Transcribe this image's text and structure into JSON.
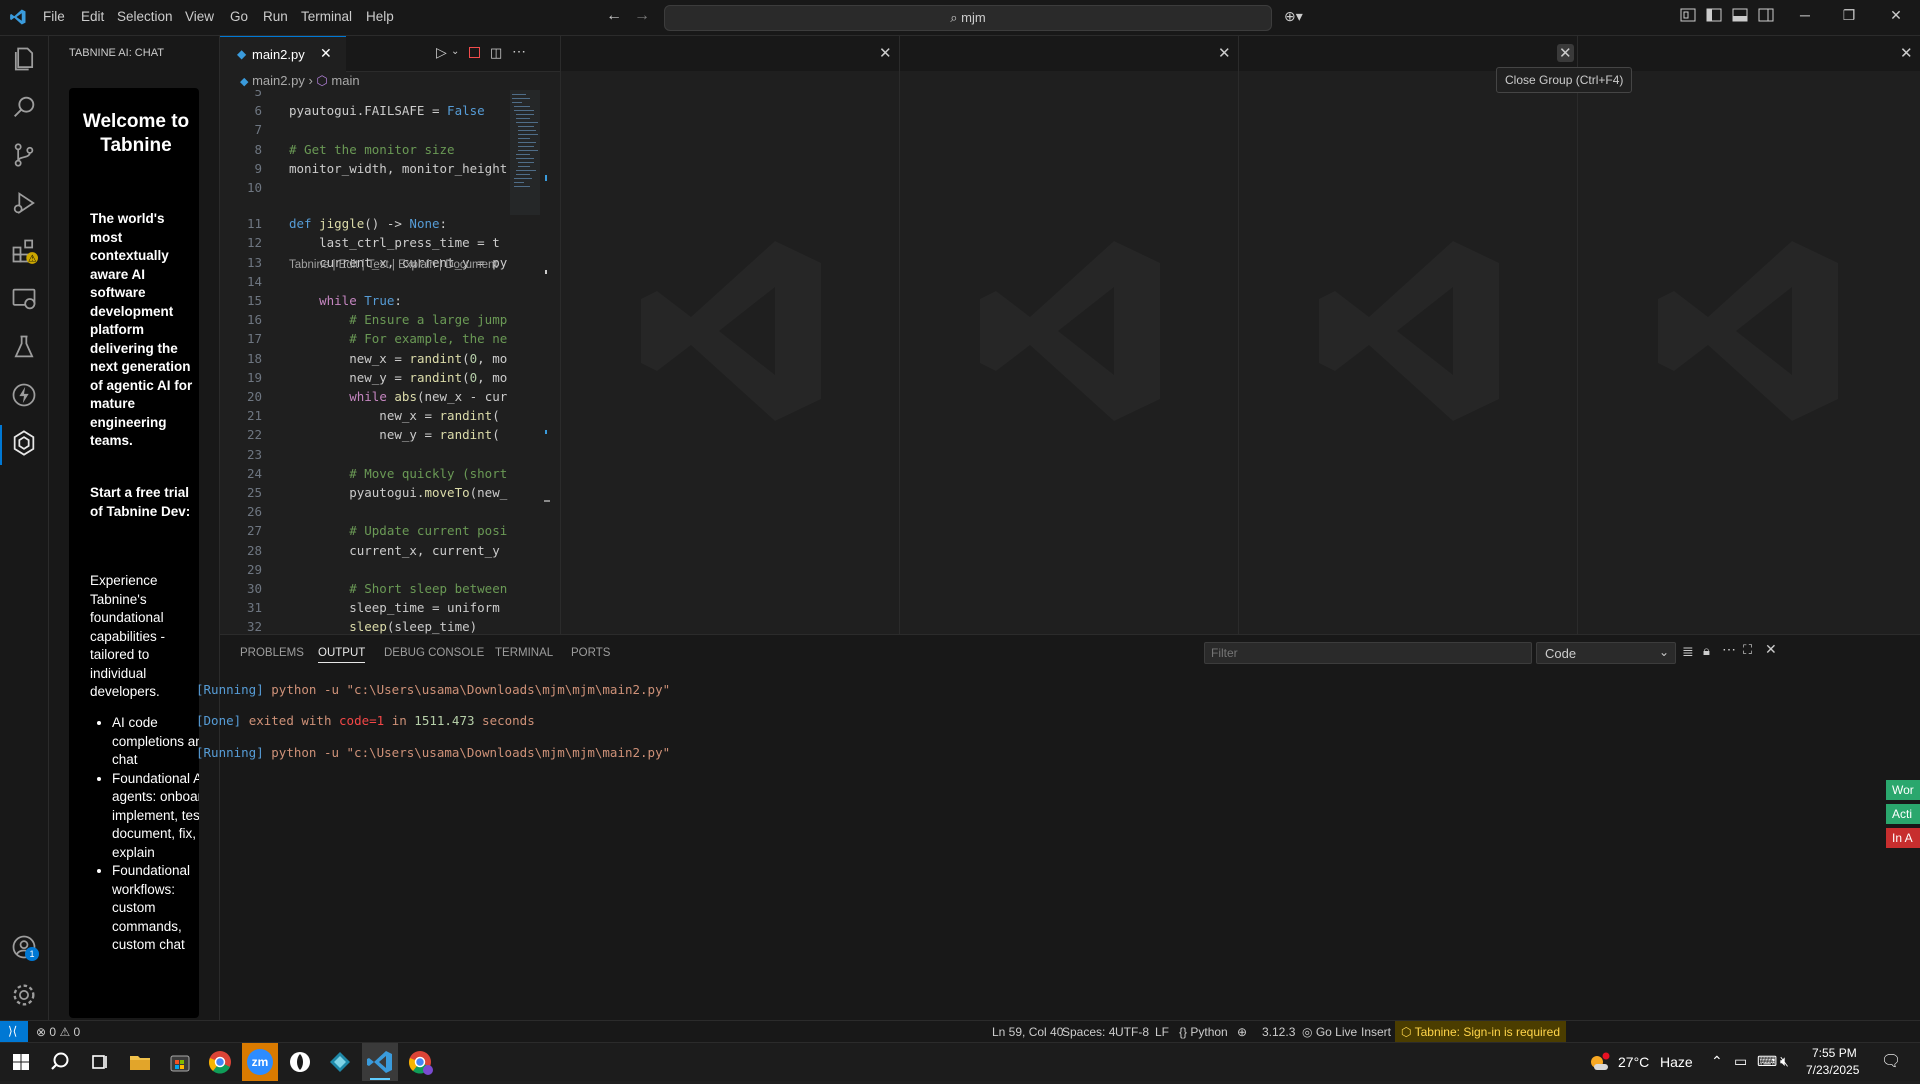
{
  "menu": [
    "File",
    "Edit",
    "Selection",
    "View",
    "Go",
    "Run",
    "Terminal",
    "Help"
  ],
  "command_center": "mjm",
  "sidebar": {
    "title": "TABNINE AI: CHAT",
    "heading": "Welcome to Tabnine",
    "para1": "The world's most contextually aware AI software development platform delivering the next generation of agentic AI for mature engineering teams.",
    "para2": "Start a free trial of Tabnine Dev:",
    "para3": "Experience Tabnine's foundational capabilities - tailored to individual developers.",
    "list": [
      "AI code completions and chat",
      "Foundational AI agents: onboard, implement, test, document, fix, explain",
      "Foundational workflows: custom commands, custom chat"
    ]
  },
  "editor": {
    "tab_label": "main2.py",
    "breadcrumb_file": "main2.py",
    "breadcrumb_symbol": "main",
    "codelens": "Tabnine | Edit | Test | Explain | Document",
    "lines": [
      {
        "n": "5",
        "t": ""
      },
      {
        "n": "6",
        "t": "pyautogui.FAILSAFE = False"
      },
      {
        "n": "7",
        "t": ""
      },
      {
        "n": "8",
        "t": "# Get the monitor size"
      },
      {
        "n": "9",
        "t": "monitor_width, monitor_height"
      },
      {
        "n": "10",
        "t": ""
      },
      {
        "n": "11",
        "t": "def jiggle() -> None:"
      },
      {
        "n": "12",
        "t": "    last_ctrl_press_time = t"
      },
      {
        "n": "13",
        "t": "    current_x, current_y = py"
      },
      {
        "n": "14",
        "t": ""
      },
      {
        "n": "15",
        "t": "    while True:"
      },
      {
        "n": "16",
        "t": "        # Ensure a large jump"
      },
      {
        "n": "17",
        "t": "        # For example, the ne"
      },
      {
        "n": "18",
        "t": "        new_x = randint(0, mo"
      },
      {
        "n": "19",
        "t": "        new_y = randint(0, mo"
      },
      {
        "n": "20",
        "t": "        while abs(new_x - cur"
      },
      {
        "n": "21",
        "t": "            new_x = randint("
      },
      {
        "n": "22",
        "t": "            new_y = randint("
      },
      {
        "n": "23",
        "t": ""
      },
      {
        "n": "24",
        "t": "        # Move quickly (short"
      },
      {
        "n": "25",
        "t": "        pyautogui.moveTo(new_"
      },
      {
        "n": "26",
        "t": ""
      },
      {
        "n": "27",
        "t": "        # Update current posi"
      },
      {
        "n": "28",
        "t": "        current_x, current_y"
      },
      {
        "n": "29",
        "t": ""
      },
      {
        "n": "30",
        "t": "        # Short sleep between"
      },
      {
        "n": "31",
        "t": "        sleep_time = uniform"
      },
      {
        "n": "32",
        "t": "        sleep(sleep_time)"
      }
    ]
  },
  "tooltip": "Close Group (Ctrl+F4)",
  "panel": {
    "tabs": [
      "PROBLEMS",
      "OUTPUT",
      "DEBUG CONSOLE",
      "TERMINAL",
      "PORTS"
    ],
    "filter_placeholder": "Filter",
    "channel": "Code",
    "out1_tag": "[Running]",
    "out1_cmd": "python -u \"c:\\Users\\usama\\Downloads\\mjm\\mjm\\main2.py\"",
    "out2_tag": "[Done]",
    "out2_a": "exited with",
    "out2_code": "code=1",
    "out2_b": "in",
    "out2_num": "1511.473",
    "out2_c": "seconds",
    "out3_tag": "[Running]",
    "out3_cmd": "python -u \"c:\\Users\\usama\\Downloads\\mjm\\mjm\\main2.py\""
  },
  "statusbar": {
    "errors": "0",
    "warnings": "0",
    "position": "Ln 59, Col 40",
    "spaces": "Spaces: 4",
    "encoding": "UTF-8",
    "eol": "LF",
    "language": "Python",
    "version": "3.12.3",
    "golive": "Go Live",
    "mode": "Insert",
    "tabnine": "Tabnine: Sign-in is required",
    "side_notes": [
      "Wor",
      "Acti",
      "In A"
    ]
  },
  "taskbar": {
    "temperature": "27°C",
    "weather": "Haze",
    "time": "7:55 PM",
    "date": "7/23/2025",
    "zoom_label": "zm"
  },
  "accounts_badge": "1"
}
